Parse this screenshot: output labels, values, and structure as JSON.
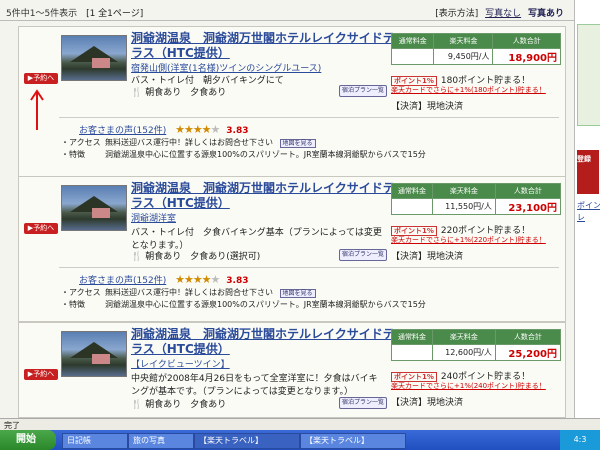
{
  "topbar": {
    "count": "5件中1～5件表示",
    "pages": "[1 全1ページ]",
    "view_label": "[表示方法]",
    "view_none": "写真なし",
    "view_photo": "写真あり"
  },
  "price_headers": {
    "normal": "通常料金",
    "rakuten": "楽天料金",
    "total": "人数合計"
  },
  "common": {
    "reserve_label": "予約へ",
    "map_label": "宿泊プラン一覧",
    "access_label": "・アクセス",
    "feature_label": "・特徴",
    "reviews_prefix": "お客さまの声",
    "small_map_label": "地図を見る",
    "points_badge": "ポイント1%"
  },
  "hotels": [
    {
      "name": "洞爺湖温泉　洞爺湖万世閣ホテルレイクサイドテラス（HTC提供）",
      "plan": "宿発山側(洋室(1名様)ツインのシングルユース)",
      "plan2": "",
      "desc": "バス・トイレ付　朝夕バイキングにて",
      "meals": "朝食あり　夕食あり",
      "normal_price": "",
      "rakuten_price": "9,450円/人",
      "total_price": "18,900円",
      "points": "180ポイント貯まる！",
      "promo": "楽天カードでさらに+1%(180ポイント)貯まる！",
      "payment": "【決済】現地決済",
      "reviews_count": "(152件)",
      "score": "3.83",
      "access": "無料送迎バス運行中！詳しくはお問合せ下さい",
      "feature": "洞爺湖温泉中心に位置する源泉100%のスパリゾート。JR室蘭本線洞爺駅からバスで15分"
    },
    {
      "name": "洞爺湖温泉　洞爺湖万世閣ホテルレイクサイドテラス（HTC提供）",
      "plan": "洞爺湖洋室",
      "plan2": "",
      "desc": "バス・トイレ付　夕食バイキング基本（プランによっては変更となります。）",
      "meals": "朝食あり　夕食あり(選択可)",
      "normal_price": "",
      "rakuten_price": "11,550円/人",
      "total_price": "23,100円",
      "points": "220ポイント貯まる！",
      "promo": "楽天カードでさらに+1%(220ポイント)貯まる！",
      "payment": "【決済】現地決済",
      "reviews_count": "(152件)",
      "score": "3.83",
      "access": "無料送迎バス運行中！詳しくはお問合せ下さい",
      "feature": "洞爺湖温泉中心に位置する源泉100%のスパリゾート。JR室蘭本線洞爺駅からバスで15分"
    },
    {
      "name": "洞爺湖温泉　洞爺湖万世閣ホテルレイクサイドテラス（HTC提供）",
      "plan": "【レイクビューツイン】",
      "plan2": "",
      "desc": "中央館が2008年4月26日をもって全室洋室に！夕食はバイキングが基本です。（プランによっては変更となります。）",
      "meals": "朝食あり　夕食あり",
      "normal_price": "",
      "rakuten_price": "12,600円/人",
      "total_price": "25,200円",
      "points": "240ポイント貯まる！",
      "promo": "楽天カードでさらに+1%(240ポイント)貯まる！",
      "payment": "【決済】現地決済",
      "reviews_count": "",
      "score": "",
      "access": "",
      "feature": ""
    }
  ],
  "sidebar": {
    "red_label": "登録",
    "link1": "ポイン",
    "link2": "レ"
  },
  "status": {
    "text": "完了"
  },
  "taskbar": {
    "start": "開始",
    "item1": "日記帳",
    "item2": "旅の写真",
    "item3": "【楽天トラベル】",
    "item4": "【楽天トラベル】",
    "tray": "4:3"
  },
  "colors": {
    "accent_red": "#c82020",
    "link_blue": "#2a4a9a",
    "price_green": "#4a8a4a"
  }
}
